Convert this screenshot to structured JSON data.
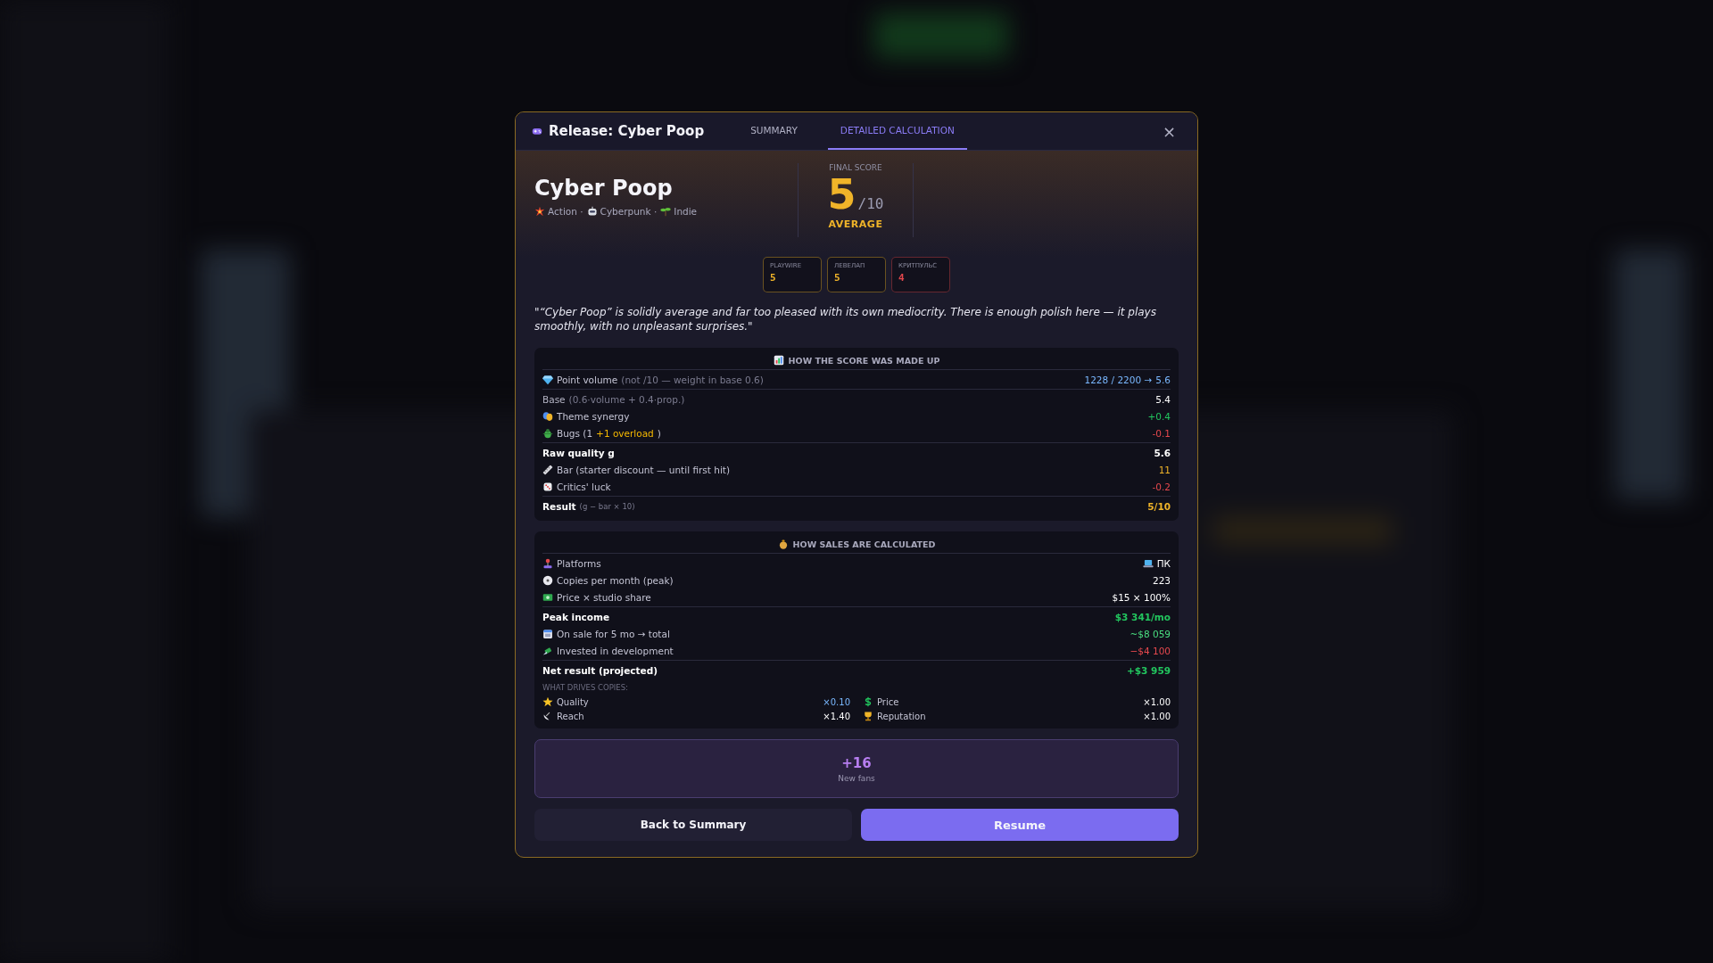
{
  "dialog": {
    "title": "Release: Cyber Poop",
    "close": "×"
  },
  "tabs": [
    {
      "label": "SUMMARY",
      "selected": false
    },
    {
      "label": "DETAILED CALCULATION",
      "selected": true
    }
  ],
  "game": {
    "name": "Cyber Poop",
    "genres": [
      "Action ·",
      "Cyberpunk ·",
      "Indie"
    ]
  },
  "score": {
    "label": "FINAL SCORE",
    "value": "5",
    "max": "/10",
    "verdict": "AVERAGE"
  },
  "critics": [
    {
      "name": "PLAYWIRE",
      "score": "5",
      "color": "#f0b429"
    },
    {
      "name": "ЛЕВЕЛАП",
      "score": "5",
      "color": "#f0b429"
    },
    {
      "name": "КРИТПУЛЬС",
      "score": "4",
      "color": "#e5484d"
    }
  ],
  "quote": "\"“Cyber Poop” is solidly average and far too pleased with its own mediocrity. There is enough polish here — it plays smoothly, with no unpleasant surprises.\"",
  "score_breakdown": {
    "title": "HOW THE SCORE WAS MADE UP",
    "groups": [
      [
        {
          "kind": "item",
          "parts": [
            {
              "text": "Point volume"
            }
          ],
          "note": "(not /10 — weight in base 0.6)",
          "value": "1228 / 2200 →",
          "accent": "5.6",
          "color": "#7ab8ff"
        }
      ],
      [
        {
          "kind": "plain",
          "parts": [
            {
              "text": "Base"
            }
          ],
          "note": "(0.6·volume + 0.4·prop.)",
          "value": "5.4",
          "color": "#ffffff"
        },
        {
          "kind": "item",
          "parts": [
            {
              "text": "Theme synergy"
            }
          ],
          "value": "+0.4",
          "color": "#22c55e"
        },
        {
          "kind": "item",
          "parts": [
            {
              "text": "Bugs (1 "
            },
            {
              "text": "+1 overload",
              "color": "#f5b800"
            },
            {
              "text": ")"
            }
          ],
          "value": "-0.1",
          "color": "#e5484d"
        }
      ],
      [
        {
          "kind": "total",
          "parts": [
            {
              "text": "Raw quality g"
            }
          ],
          "value": "5.6",
          "color": "#ffffff"
        },
        {
          "kind": "item",
          "parts": [
            {
              "text": "Bar (starter discount — until first hit)"
            }
          ],
          "value": "11",
          "color": "#f0b429"
        },
        {
          "kind": "item",
          "parts": [
            {
              "text": "Critics' luck"
            }
          ],
          "value": "-0.2",
          "color": "#e5484d"
        }
      ],
      [
        {
          "kind": "total",
          "parts": [
            {
              "text": "Result"
            }
          ],
          "note": "(g − bar × 10)",
          "value": "5/10",
          "color": "#f0b429"
        }
      ]
    ]
  },
  "sales_breakdown": {
    "title": "HOW SALES ARE CALCULATED",
    "groups": [
      [
        {
          "kind": "item",
          "parts": [
            {
              "text": "Platforms"
            }
          ],
          "value": "ПК",
          "color": "#ffffff"
        },
        {
          "kind": "item",
          "parts": [
            {
              "text": "Copies per month (peak)"
            }
          ],
          "value": "223",
          "color": "#ffffff"
        },
        {
          "kind": "item",
          "parts": [
            {
              "text": "Price × studio share"
            }
          ],
          "value": "$15 × 100%",
          "color": "#ffffff"
        }
      ],
      [
        {
          "kind": "total",
          "parts": [
            {
              "text": "Peak income"
            }
          ],
          "value": "$3 341/mo",
          "color": "#22c55e"
        },
        {
          "kind": "item",
          "parts": [
            {
              "text": "On sale for 5 mo → total"
            }
          ],
          "value": "~$8 059",
          "color": "#4ade80"
        },
        {
          "kind": "item",
          "parts": [
            {
              "text": "Invested in development"
            }
          ],
          "value": "−$4 100",
          "color": "#e5484d"
        }
      ],
      [
        {
          "kind": "total",
          "parts": [
            {
              "text": "Net result (projected)"
            }
          ],
          "value": "+$3 959",
          "color": "#22c55e"
        }
      ]
    ],
    "drivers_label": "WHAT DRIVES COPIES:",
    "drivers": [
      {
        "label": "Quality",
        "value": "×0.10",
        "color": "#7ab8ff"
      },
      {
        "label": "Price",
        "value": "×1.00",
        "color": "#ffffff"
      },
      {
        "label": "Reach",
        "value": "×1.40",
        "color": "#ffffff"
      },
      {
        "label": "Reputation",
        "value": "×1.00",
        "color": "#ffffff"
      }
    ]
  },
  "fans": {
    "value": "+16",
    "label": "New fans"
  },
  "buttons": [
    {
      "label": "Back to Summary",
      "kind": "secondary"
    },
    {
      "label": "Resume",
      "kind": "primary"
    }
  ]
}
